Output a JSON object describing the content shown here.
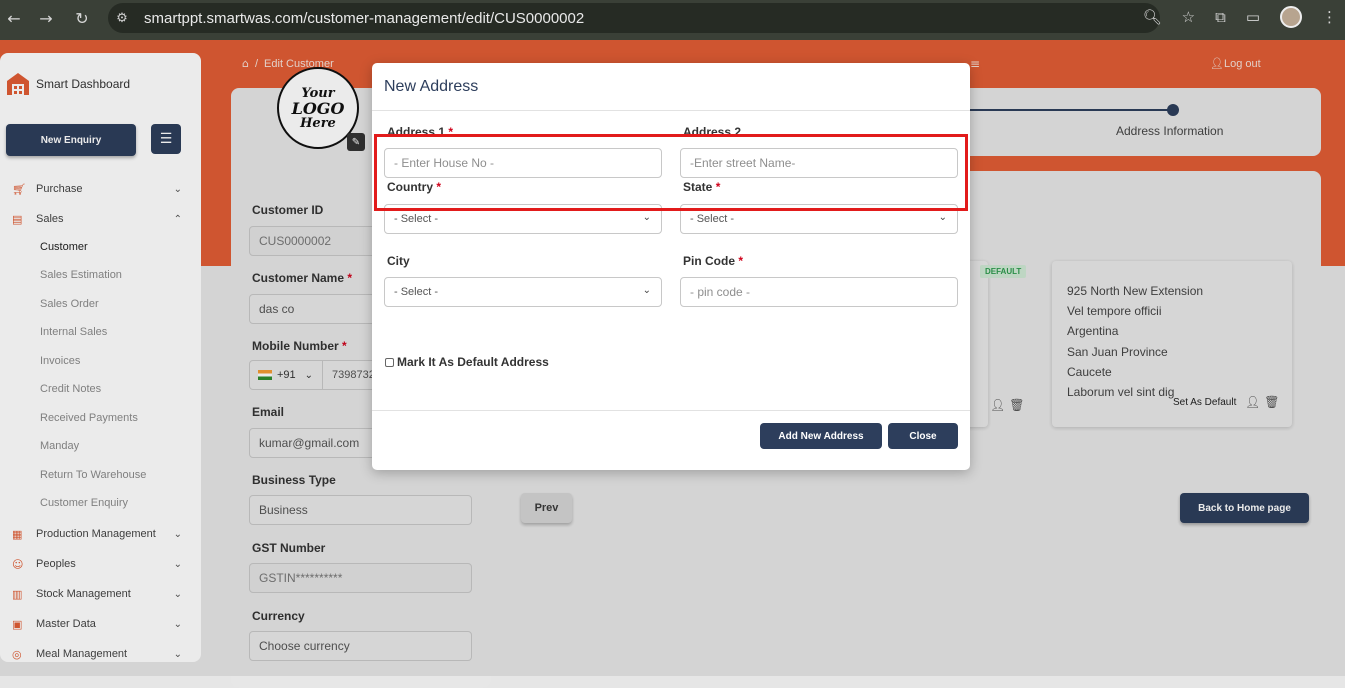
{
  "browser": {
    "url": "smartppt.smartwas.com/customer-management/edit/CUS0000002",
    "back_icon": "arrow-left-icon",
    "forward_icon": "arrow-right-icon",
    "reload_icon": "reload-icon"
  },
  "sidebar": {
    "brand": "Smart Dashboard",
    "new_enquiry": "New Enquiry",
    "items": [
      {
        "label": "Purchase",
        "icon": "cart-icon",
        "expanded": false
      },
      {
        "label": "Sales",
        "icon": "sales-icon",
        "expanded": true
      },
      {
        "label": "Production Management",
        "icon": "factory-icon",
        "expanded": false
      },
      {
        "label": "Peoples",
        "icon": "people-icon",
        "expanded": false
      },
      {
        "label": "Stock Management",
        "icon": "stock-icon",
        "expanded": false
      },
      {
        "label": "Master Data",
        "icon": "database-icon",
        "expanded": false
      },
      {
        "label": "Meal Management",
        "icon": "meal-icon",
        "expanded": false
      }
    ],
    "sales_sub": [
      {
        "label": "Customer",
        "active": true
      },
      {
        "label": "Sales Estimation",
        "active": false
      },
      {
        "label": "Sales Order",
        "active": false
      },
      {
        "label": "Internal Sales",
        "active": false
      },
      {
        "label": "Invoices",
        "active": false
      },
      {
        "label": "Credit Notes",
        "active": false
      },
      {
        "label": "Received Payments",
        "active": false
      },
      {
        "label": "Manday",
        "active": false
      },
      {
        "label": "Return To Warehouse",
        "active": false
      },
      {
        "label": "Customer Enquiry",
        "active": false
      }
    ]
  },
  "header": {
    "breadcrumb_sep": "/",
    "breadcrumb": "Edit Customer",
    "logout": "Log out"
  },
  "form": {
    "customer_id_label": "Customer ID",
    "customer_id": "CUS0000002",
    "customer_name_label": "Customer Name",
    "customer_name": "das co",
    "mobile_label": "Mobile Number",
    "phone_code": "+91",
    "phone_number": "7398732",
    "email_label": "Email",
    "email": "kumar@gmail.com",
    "business_type_label": "Business Type",
    "business_type": "Business",
    "gst_label": "GST Number",
    "gst_placeholder": "GSTIN**********",
    "currency_label": "Currency",
    "currency": "Choose currency",
    "required_mark": "*"
  },
  "logo": {
    "lines": [
      "Your",
      "LOGO",
      "Here"
    ]
  },
  "steps": {
    "current_label": "Address Information"
  },
  "address_card": {
    "badge": "DEFAULT",
    "lines": [
      "925 North New Extension",
      "Vel tempore officii",
      "Argentina",
      "San Juan Province",
      "Caucete",
      "Laborum vel sint dig"
    ],
    "set_default": "Set As Default"
  },
  "footer_buttons": {
    "prev": "Prev",
    "home": "Back to Home page"
  },
  "modal": {
    "title": "New Address",
    "address1_label": "Address 1",
    "address1_placeholder": "- Enter House No -",
    "address2_label": "Address 2",
    "address2_placeholder": "-Enter street Name-",
    "country_label": "Country",
    "country_value": "- Select -",
    "state_label": "State",
    "state_value": "- Select -",
    "city_label": "City",
    "city_value": "- Select -",
    "pincode_label": "Pin Code",
    "pincode_placeholder": "- pin code -",
    "default_checkbox": "Mark It As Default Address",
    "default_checked": false,
    "add_button": "Add New Address",
    "close_button": "Close",
    "required_mark": "*"
  },
  "colors": {
    "brand": "#e15d35",
    "navy": "#2d3e5c",
    "highlight": "#e21b1b"
  }
}
